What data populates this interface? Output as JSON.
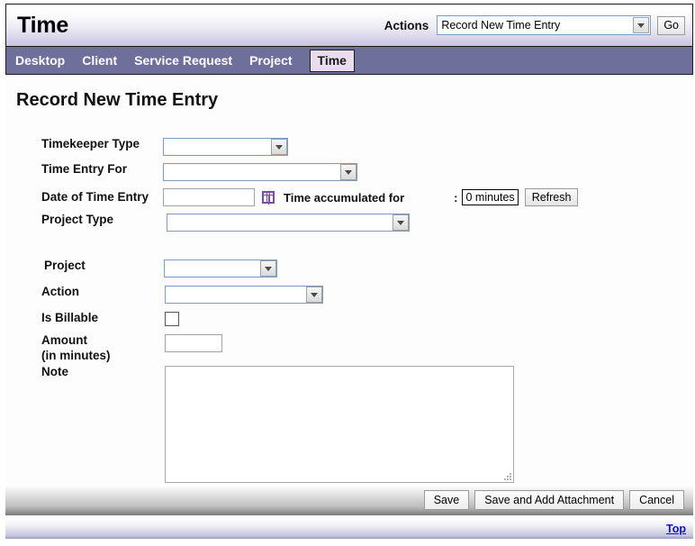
{
  "header": {
    "app_title": "Time",
    "actions_label": "Actions",
    "actions_selected": "Record New Time Entry",
    "go_label": "Go"
  },
  "nav": {
    "items": [
      {
        "label": "Desktop",
        "active": false
      },
      {
        "label": "Client",
        "active": false
      },
      {
        "label": "Service Request",
        "active": false
      },
      {
        "label": "Project",
        "active": false
      },
      {
        "label": "Time",
        "active": true
      }
    ]
  },
  "main": {
    "page_title": "Record New Time Entry",
    "fields": {
      "timekeeper_type": {
        "label": "Timekeeper Type",
        "value": ""
      },
      "time_entry_for": {
        "label": "Time Entry For",
        "value": ""
      },
      "date_of_time_entry": {
        "label": "Date of Time Entry",
        "value": ""
      },
      "project_type": {
        "label": "Project Type",
        "value": ""
      },
      "project": {
        "label": "Project",
        "value": ""
      },
      "action": {
        "label": "Action",
        "value": ""
      },
      "is_billable": {
        "label": "Is Billable",
        "checked": false
      },
      "amount": {
        "label_line1": "Amount",
        "label_line2": "(in minutes)",
        "value": ""
      },
      "note": {
        "label": "Note",
        "value": ""
      }
    },
    "accumulated": {
      "text": "Time accumulated for",
      "separator": ":",
      "value": "0 minutes",
      "refresh_label": "Refresh"
    }
  },
  "footer": {
    "save_label": "Save",
    "save_attach_label": "Save and Add Attachment",
    "cancel_label": "Cancel",
    "top_label": "Top"
  },
  "colors": {
    "nav_bg": "#6f6f9b",
    "active_tab_bg": "#e8dcee",
    "header_gradient_end": "#c9c2e0",
    "link": "#1111cc",
    "calendar_icon": "#7a4fa3"
  }
}
